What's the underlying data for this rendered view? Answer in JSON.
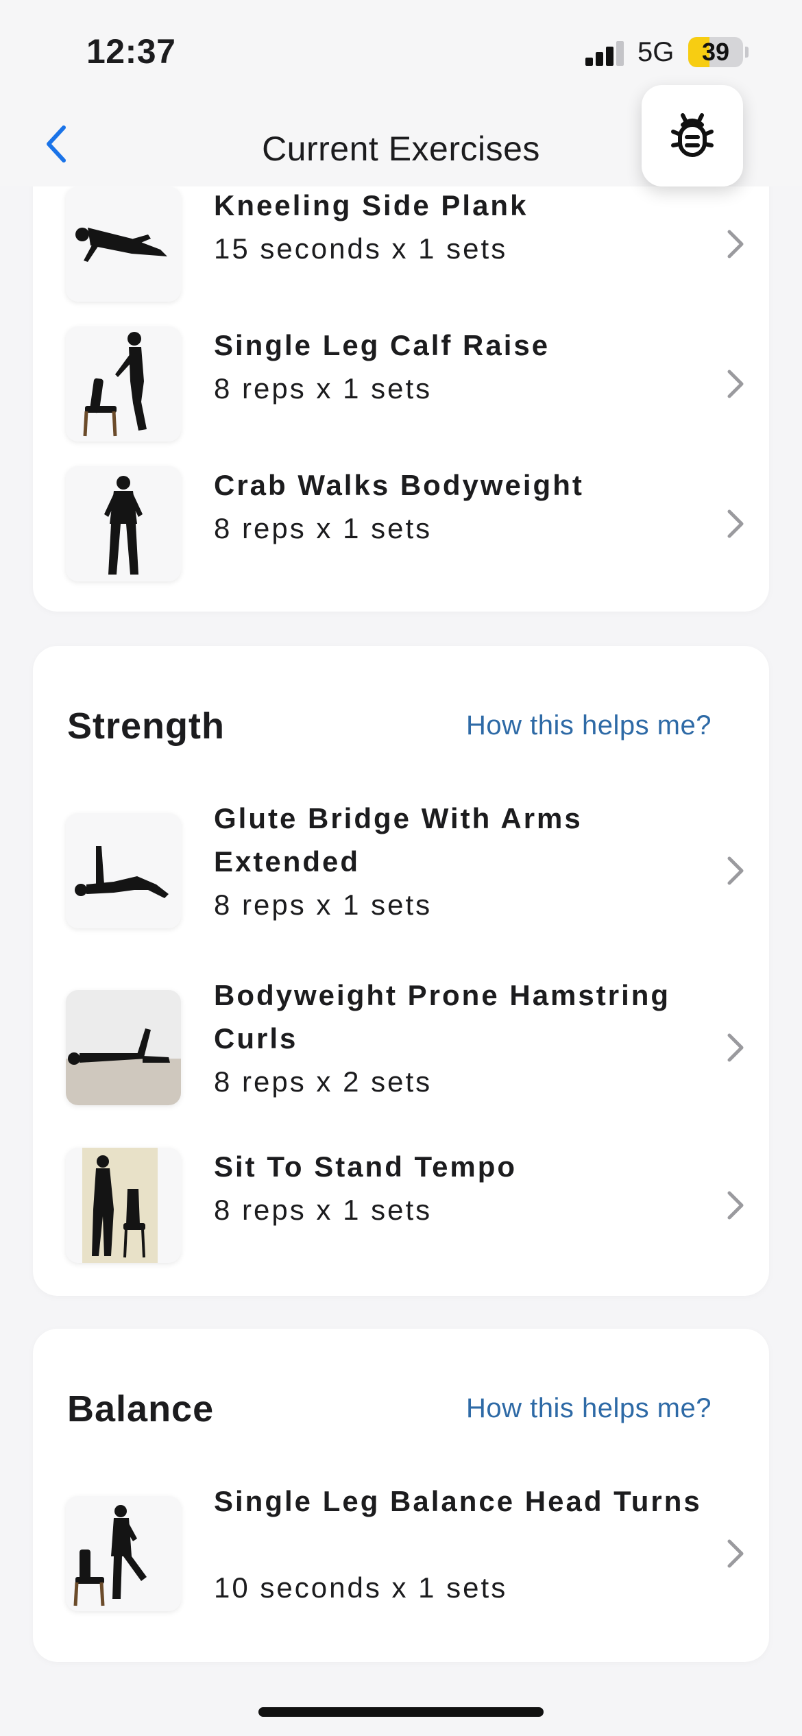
{
  "status_bar": {
    "time": "12:37",
    "network": "5G",
    "battery_level": "39",
    "battery_fraction": 0.39,
    "signal_bars_active": 3,
    "battery_fill_color": "#f7cd12"
  },
  "nav": {
    "title": "Current Exercises",
    "back_icon": "chevron-left-icon",
    "report_icon": "bug-icon",
    "accent_color": "#1a73e8"
  },
  "sections": [
    {
      "title": "",
      "help_link": "",
      "exercises": [
        {
          "name": "Kneeling Side Plank",
          "dose": "15 seconds x 1 sets"
        },
        {
          "name": "Single Leg Calf Raise",
          "dose": "8 reps x 1 sets"
        },
        {
          "name": "Crab Walks Bodyweight",
          "dose": "8 reps x 1 sets"
        }
      ]
    },
    {
      "title": "Strength",
      "help_link": "How this helps me?",
      "exercises": [
        {
          "name": "Glute Bridge With Arms Extended",
          "dose": "8 reps x 1 sets"
        },
        {
          "name": "Bodyweight Prone Hamstring Curls",
          "dose": "8 reps x 2 sets"
        },
        {
          "name": "Sit To Stand Tempo",
          "dose": "8 reps x 1 sets"
        }
      ]
    },
    {
      "title": "Balance",
      "help_link": "How this helps me?",
      "exercises": [
        {
          "name": "Single Leg Balance Head Turns",
          "dose": "10 seconds x 1 sets"
        }
      ]
    }
  ],
  "colors": {
    "link": "#2e6aa6",
    "background": "#f5f5f7",
    "card": "#ffffff"
  }
}
